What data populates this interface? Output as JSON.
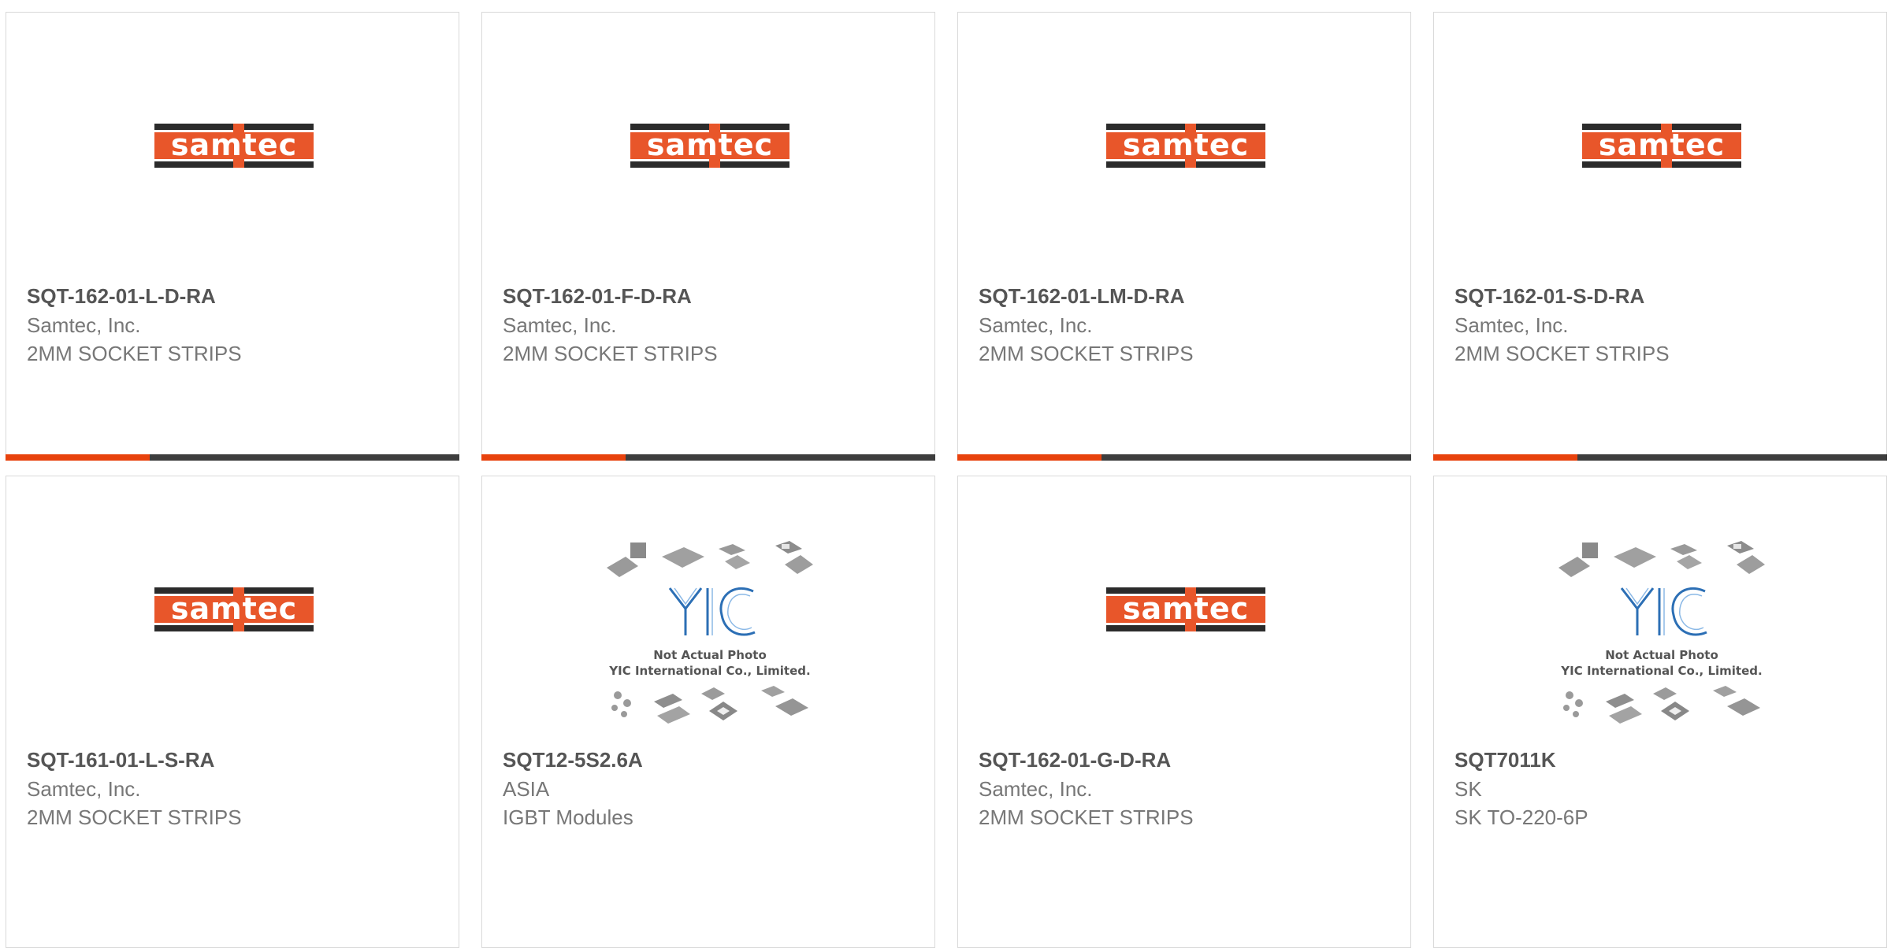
{
  "colors": {
    "accent": "#e8420d",
    "dark": "#3d3d3d",
    "logo_orange": "#e8562a"
  },
  "logos": {
    "samtec": "samtec",
    "yic_line1": "Not Actual Photo",
    "yic_line2": "YIC International Co., Limited.",
    "yic_mark": "YIC"
  },
  "products": [
    {
      "part": "SQT-162-01-L-D-RA",
      "manufacturer": "Samtec, Inc.",
      "description": "2MM SOCKET STRIPS",
      "image": "samtec-logo"
    },
    {
      "part": "SQT-162-01-F-D-RA",
      "manufacturer": "Samtec, Inc.",
      "description": "2MM SOCKET STRIPS",
      "image": "samtec-logo"
    },
    {
      "part": "SQT-162-01-LM-D-RA",
      "manufacturer": "Samtec, Inc.",
      "description": "2MM SOCKET STRIPS",
      "image": "samtec-logo"
    },
    {
      "part": "SQT-162-01-S-D-RA",
      "manufacturer": "Samtec, Inc.",
      "description": "2MM SOCKET STRIPS",
      "image": "samtec-logo"
    },
    {
      "part": "SQT-161-01-L-S-RA",
      "manufacturer": "Samtec, Inc.",
      "description": "2MM SOCKET STRIPS",
      "image": "samtec-logo"
    },
    {
      "part": "SQT12-5S2.6A",
      "manufacturer": "ASIA",
      "description": "IGBT Modules",
      "image": "not-actual-photo"
    },
    {
      "part": "SQT-162-01-G-D-RA",
      "manufacturer": "Samtec, Inc.",
      "description": "2MM SOCKET STRIPS",
      "image": "samtec-logo"
    },
    {
      "part": "SQT7011K",
      "manufacturer": "SK",
      "description": "SK TO-220-6P",
      "image": "not-actual-photo"
    }
  ]
}
